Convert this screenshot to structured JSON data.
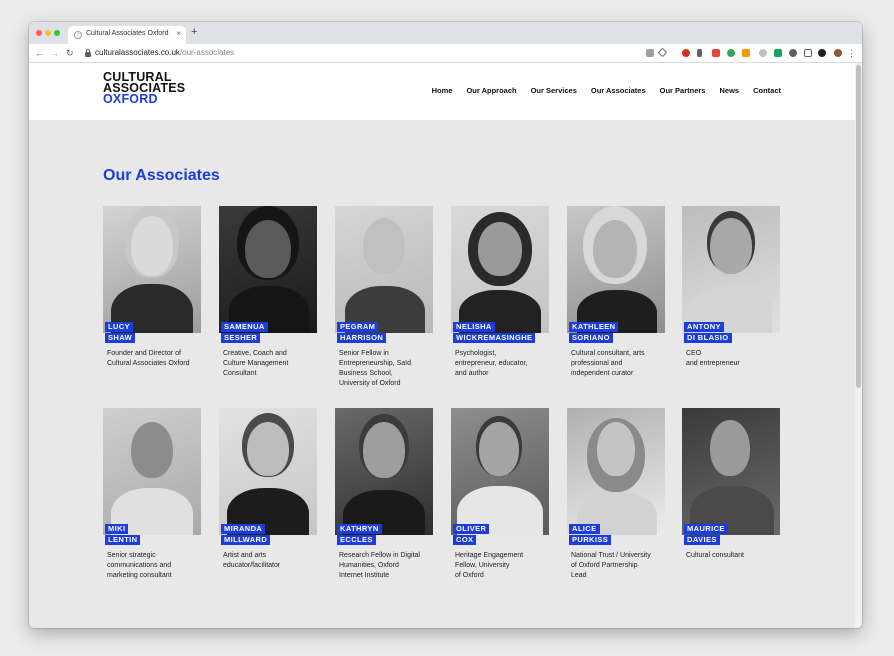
{
  "browser": {
    "tab_title": "Cultural Associates Oxford",
    "tab_close": "×",
    "new_tab": "+",
    "url_domain": "culturalassociates.co.uk",
    "url_path": "/our-associates",
    "back": "←",
    "forward": "→",
    "reload": "↻"
  },
  "site": {
    "logo": {
      "line1": "CULTURAL",
      "line2": "ASSOCIATES",
      "line3": "OXFORD"
    },
    "nav": [
      "Home",
      "Our Approach",
      "Our Services",
      "Our Associates",
      "Our Partners",
      "News",
      "Contact"
    ],
    "heading": "Our Associates"
  },
  "associates": [
    {
      "first": "LUCY",
      "last": "SHAW",
      "role": "Founder and Director of\nCultural Associates Oxford"
    },
    {
      "first": "SAMENUA",
      "last": "SESHER",
      "role": "Creative, Coach and\nCulture Management\nConsultant"
    },
    {
      "first": "PEGRAM",
      "last": "HARRISON",
      "role": "Senior Fellow in\nEntrepreneurship, Saïd\nBusiness School,\nUniversity of Oxford"
    },
    {
      "first": "NELISHA",
      "last": "WICKREMASINGHE",
      "role": "Psychologist,\nentrepreneur, educator,\nand author"
    },
    {
      "first": "KATHLEEN",
      "last": "SORIANO",
      "role": "Cultural consultant, arts\nprofessional and\nindependent curator"
    },
    {
      "first": "ANTONY",
      "last": "DI BLASIO",
      "role": "CEO\nand entrepreneur"
    },
    {
      "first": "MIKI",
      "last": "LENTIN",
      "role": "Senior strategic\ncommunications and\nmarketing consultant"
    },
    {
      "first": "MIRANDA",
      "last": "MILLWARD",
      "role": "Artist and arts\neducator/facilitator"
    },
    {
      "first": "KATHRYN",
      "last": "ECCLES",
      "role": "Research Fellow in Digital\nHumanities, Oxford\nInternet Institute"
    },
    {
      "first": "OLIVER",
      "last": "COX",
      "role": "Heritage Engagement\nFellow, University\nof Oxford"
    },
    {
      "first": "ALICE",
      "last": "PURKISS",
      "role": "National Trust / University\nof Oxford Partnership\nLead"
    },
    {
      "first": "MAURICE",
      "last": "DAVIES",
      "role": "Cultural consultant"
    }
  ],
  "colors": {
    "accent": "#1d3ddb",
    "page_bg": "#e8e8e8"
  }
}
